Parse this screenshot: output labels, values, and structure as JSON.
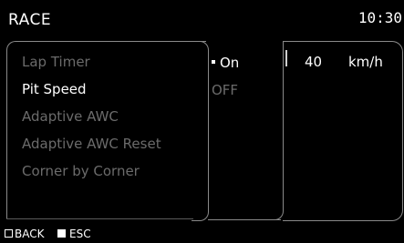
{
  "header": {
    "title": "RACE",
    "clock": "10:30"
  },
  "menu": {
    "items": [
      {
        "label": "Lap Timer",
        "active": false
      },
      {
        "label": "Pit Speed",
        "active": true
      },
      {
        "label": "Adaptive AWC",
        "active": false
      },
      {
        "label": "Adaptive AWC Reset",
        "active": false
      },
      {
        "label": "Corner by Corner",
        "active": false
      }
    ]
  },
  "options": {
    "on_label": "On",
    "off_label": "OFF"
  },
  "speed": {
    "value": "40",
    "unit": "km/h"
  },
  "footer": {
    "back_label": "BACK",
    "esc_label": "ESC"
  },
  "colors": {
    "background": "#000000",
    "text": "#ffffff",
    "inactive_text": "#6b6b6b",
    "border": "#8a8a8a"
  }
}
